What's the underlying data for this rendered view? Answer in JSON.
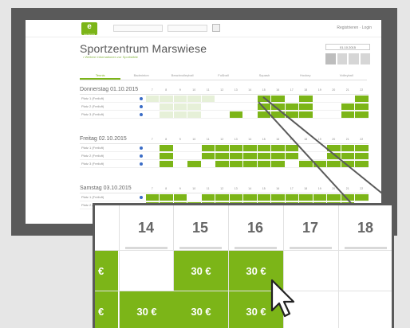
{
  "header": {
    "logo": "e",
    "logo_sub": "eversports",
    "login_link": "Registrieren · Login"
  },
  "page": {
    "title": "Sportzentrum Marswiese",
    "sub_link": "• Weitere Informationen zur Sportstätte",
    "date_picker": "01.10.2015"
  },
  "tabs": [
    "Tennis",
    "Badminton",
    "Beachvolleyball",
    "Fußball",
    "Squash",
    "Hockey",
    "Volleyball"
  ],
  "hours": [
    "7",
    "8",
    "9",
    "10",
    "11",
    "12",
    "13",
    "14",
    "15",
    "16",
    "17",
    "18",
    "19",
    "20",
    "21",
    "22"
  ],
  "days": [
    {
      "label": "Donnerstag 01.10.2015",
      "courts": [
        {
          "name": "Platz 1 (Freiluft)",
          "cells": "lllll...gg.g...gg"
        },
        {
          "name": "Platz 2 (Freiluft)",
          "cells": ".lll....gggg..gg"
        },
        {
          "name": "Platz 3 (Freiluft)",
          "cells": ".lll..g.gggg..ggg"
        }
      ]
    },
    {
      "label": "Freitag 02.10.2015",
      "courts": [
        {
          "name": "Platz 1 (Freiluft)",
          "cells": ".g..ggggggg..ggg"
        },
        {
          "name": "Platz 2 (Freiluft)",
          "cells": ".g..ggggggg..ggg"
        },
        {
          "name": "Platz 3 (Freiluft)",
          "cells": ".g.g.ggggg.ggggg"
        }
      ]
    },
    {
      "label": "Samstag 03.10.2015",
      "courts": [
        {
          "name": "Platz 1 (Freiluft)",
          "cells": "ggg.gggggggggggg"
        },
        {
          "name": "Platz 2 (Freiluft)",
          "cells": "ggggggggggggggg"
        }
      ]
    }
  ],
  "zoom": {
    "hours": [
      "14",
      "15",
      "16",
      "17",
      "18"
    ],
    "row1": {
      "left_fragment": "€",
      "cells": [
        "",
        "30 €",
        "30 €",
        "",
        ""
      ]
    },
    "row2": {
      "left_fragment": "€",
      "cells": [
        "30 €",
        "30 €",
        "30 €",
        "",
        ""
      ]
    }
  },
  "colors": {
    "accent": "#7cb518",
    "frame": "#5a5a5a",
    "court_dot": "#3a6cc6"
  }
}
